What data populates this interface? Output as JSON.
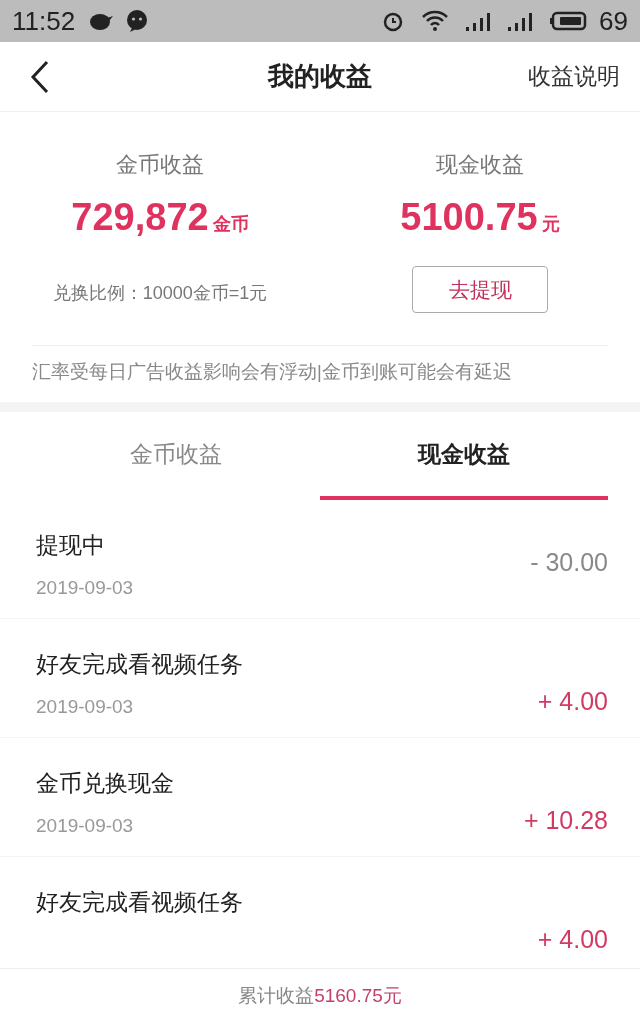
{
  "status_bar": {
    "time": "11:52",
    "battery": "69"
  },
  "header": {
    "title": "我的收益",
    "action": "收益说明"
  },
  "summary": {
    "columns": [
      {
        "label": "金币收益",
        "value": "729,872",
        "unit": "金币"
      },
      {
        "label": "现金收益",
        "value": "5100.75",
        "unit": "元"
      }
    ],
    "rate": "兑换比例：10000金币=1元",
    "withdraw_button": "去提现",
    "notice": "汇率受每日广告收益影响会有浮动|金币到账可能会有延迟"
  },
  "tabs": [
    {
      "label": "金币收益",
      "selected": false
    },
    {
      "label": "现金收益",
      "selected": true
    }
  ],
  "records": [
    {
      "title": "提现中",
      "date": "2019-09-03",
      "amount": "- 30.00",
      "kind": "debit"
    },
    {
      "title": "好友完成看视频任务",
      "date": "2019-09-03",
      "amount": "+ 4.00",
      "kind": "credit"
    },
    {
      "title": "金币兑换现金",
      "date": "2019-09-03",
      "amount": "+ 10.28",
      "kind": "credit"
    },
    {
      "title": "好友完成看视频任务",
      "amount": "+ 4.00",
      "kind": "credit"
    }
  ],
  "footer": {
    "label": "累计收益",
    "total": "5160.75元"
  }
}
